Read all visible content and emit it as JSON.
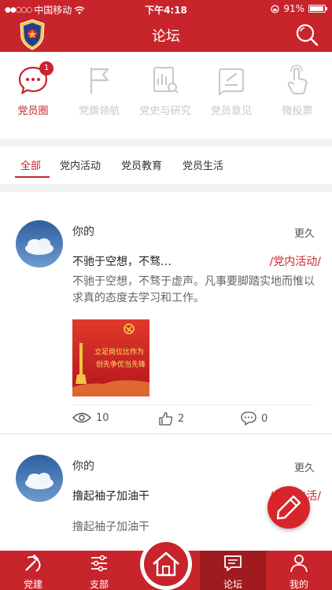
{
  "status_bar": {
    "carrier": "中国移动",
    "time": "下午4:18",
    "battery_percent": "91%"
  },
  "nav": {
    "title": "论坛"
  },
  "categories": [
    {
      "label": "党员圈",
      "badge": "1",
      "active": true
    },
    {
      "label": "党旗领航"
    },
    {
      "label": "党史与研究"
    },
    {
      "label": "党员意见"
    },
    {
      "label": "微投票"
    }
  ],
  "tabs": [
    "全部",
    "党内活动",
    "党员教育",
    "党员生活"
  ],
  "posts": [
    {
      "author": "你的",
      "time": "更久",
      "title": "不驰于空想，不骛…",
      "category": "/党内活动/",
      "body": "不驰于空想，不骛于虚声。凡事要脚踏实地而惟以求真的态度去学习和工作。",
      "image_text": [
        "立足岗位比作为",
        "创先争优当先锋"
      ],
      "views": "10",
      "likes": "2",
      "comments": "0"
    },
    {
      "author": "你的",
      "time": "更久",
      "title": "撸起袖子加油干",
      "category": "/党员生活/",
      "body": "撸起袖子加油干"
    }
  ],
  "tabbar": [
    {
      "label": "党建"
    },
    {
      "label": "支部"
    },
    {
      "label": "论坛",
      "active": true
    },
    {
      "label": "我的"
    }
  ],
  "colors": {
    "brand_red": "#c8242b",
    "active_tab_red": "#9f1b20",
    "inactive_gray": "#c8c8c8"
  }
}
